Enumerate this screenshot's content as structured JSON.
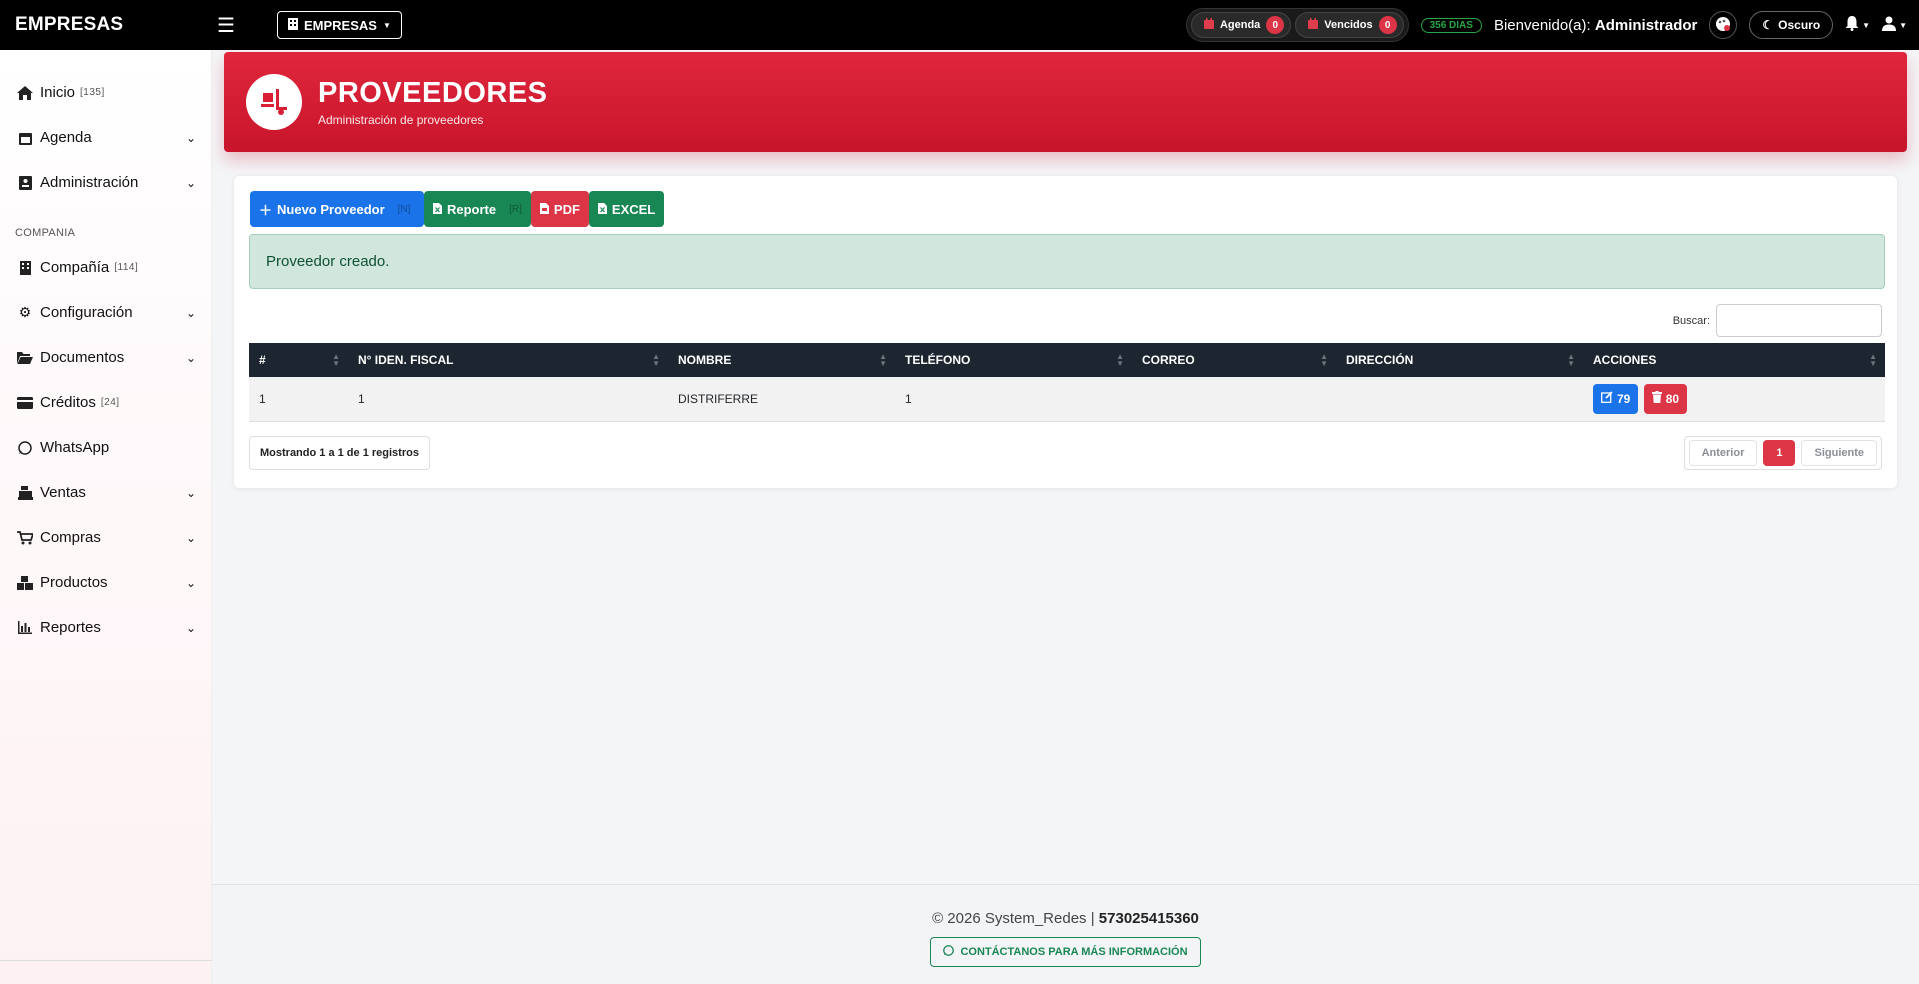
{
  "topbar": {
    "brand": "EMPRESAS",
    "company_selector": "EMPRESAS",
    "agenda_label": "Agenda",
    "agenda_count": "0",
    "vencidos_label": "Vencidos",
    "vencidos_count": "0",
    "days_badge": "356 DIAS",
    "welcome_prefix": "Bienvenido(a):",
    "welcome_user": "Administrador",
    "theme_label": "Oscuro"
  },
  "sidebar": {
    "items": [
      {
        "label": "Inicio",
        "count": "[135]"
      },
      {
        "label": "Agenda"
      },
      {
        "label": "Administración"
      }
    ],
    "section_title": "COMPANIA",
    "items2": [
      {
        "label": "Compañía",
        "count": "[114]"
      },
      {
        "label": "Configuración"
      },
      {
        "label": "Documentos"
      },
      {
        "label": "Créditos",
        "count": "[24]"
      },
      {
        "label": "WhatsApp"
      },
      {
        "label": "Ventas"
      },
      {
        "label": "Compras"
      },
      {
        "label": "Productos"
      },
      {
        "label": "Reportes"
      }
    ]
  },
  "header": {
    "title": "PROVEEDORES",
    "subtitle": "Administración de proveedores"
  },
  "toolbar": {
    "new_label": "Nuevo Proveedor",
    "new_shortcut": "[N]",
    "report_label": "Reporte",
    "report_shortcut": "[R]",
    "pdf_label": "PDF",
    "excel_label": "EXCEL"
  },
  "alert": {
    "message": "Proveedor creado."
  },
  "search": {
    "label": "Buscar:"
  },
  "table": {
    "columns": [
      "#",
      "N° IDEN. FISCAL",
      "NOMBRE",
      "TELÉFONO",
      "CORREO",
      "DIRECCIÓN",
      "ACCIONES"
    ],
    "rows": [
      {
        "num": "1",
        "fiscal": "1",
        "nombre": "DISTRIFERRE",
        "telefono": "1",
        "correo": "",
        "direccion": "",
        "edit_id": "79",
        "delete_id": "80"
      }
    ]
  },
  "pagination": {
    "info": "Mostrando 1 a 1 de 1 registros",
    "prev": "Anterior",
    "current": "1",
    "next": "Siguiente"
  },
  "footer": {
    "copyright": "© 2026 System_Redes |",
    "phone": "573025415360",
    "contact": "CONTÁCTANOS PARA MÁS INFORMACIÓN"
  },
  "colors": {
    "header_red": "#d81f35",
    "primary_blue": "#1a73e8",
    "success_green": "#198754",
    "danger_red": "#dc3545"
  }
}
